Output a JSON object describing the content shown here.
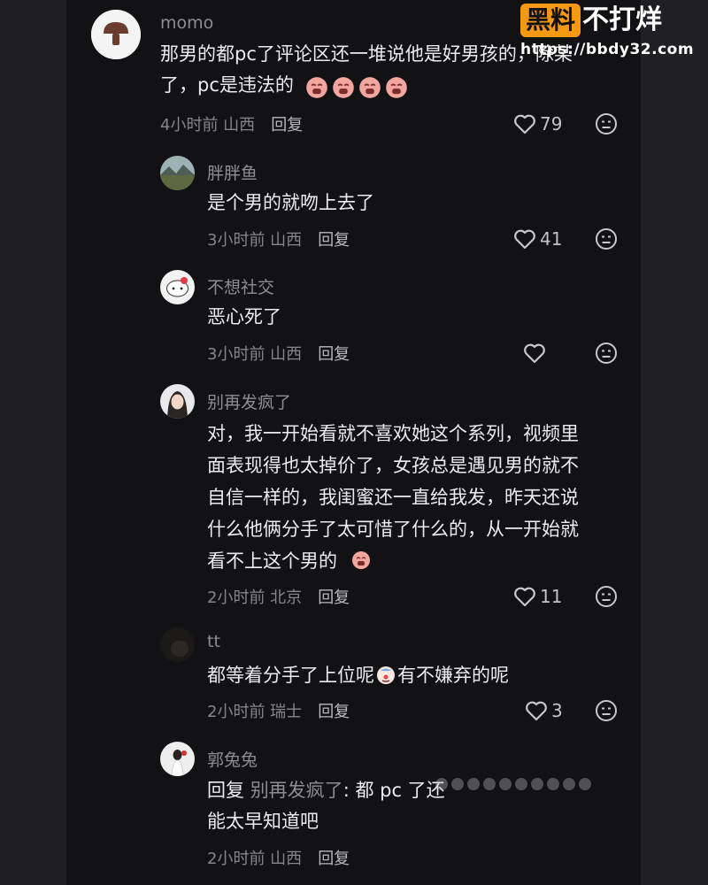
{
  "watermark": {
    "brand_box": "黑料",
    "brand_text": "不打烊",
    "url": "https://bbdy32.com"
  },
  "comments": [
    {
      "username": "momo",
      "text_lines": [
        "那男的都pc了评论区还一堆说他是好男孩的，除某",
        "了，pc是违法的"
      ],
      "emoji_count": 4,
      "meta": "4小时前 山西",
      "reply_label": "回复",
      "likes": "79"
    },
    {
      "username": "胖胖鱼",
      "text_lines": [
        "是个男的就吻上去了"
      ],
      "meta": "3小时前 山西",
      "reply_label": "回复",
      "likes": "41"
    },
    {
      "username": "不想社交",
      "text_lines": [
        "恶心死了"
      ],
      "meta": "3小时前 山西",
      "reply_label": "回复",
      "likes": ""
    },
    {
      "username": "别再发疯了",
      "text_lines": [
        "对，我一开始看就不喜欢她这个系列，视频里",
        "面表现得也太掉价了，女孩总是遇见男的就不",
        "自信一样的，我闺蜜还一直给我发，昨天还说",
        "什么他俩分手了太可惜了什么的，从一开始就",
        "看不上这个男的"
      ],
      "meta": "2小时前 北京",
      "reply_label": "回复",
      "likes": "11"
    },
    {
      "username": "tt",
      "text_lines": [
        "都等着分手了上位呢",
        "有不嫌弃的呢"
      ],
      "meta": "2小时前 瑞士",
      "reply_label": "回复",
      "likes": "3"
    },
    {
      "username": "郭兔兔",
      "reply_prefix": "回复",
      "reply_target": "别再发疯了",
      "reply_text": ": 都 pc 了还",
      "text_line2": "能太早知道吧",
      "meta": "2小时前 山西",
      "reply_label": "回复"
    }
  ],
  "icons": {
    "like": "heart-outline-icon",
    "dislike": "meh-face-icon",
    "emoji": "crying-face-icon",
    "emoji2": "sobbing-clown-face-icon"
  },
  "colors": {
    "accent": "#f39a12",
    "background": "#121214"
  }
}
